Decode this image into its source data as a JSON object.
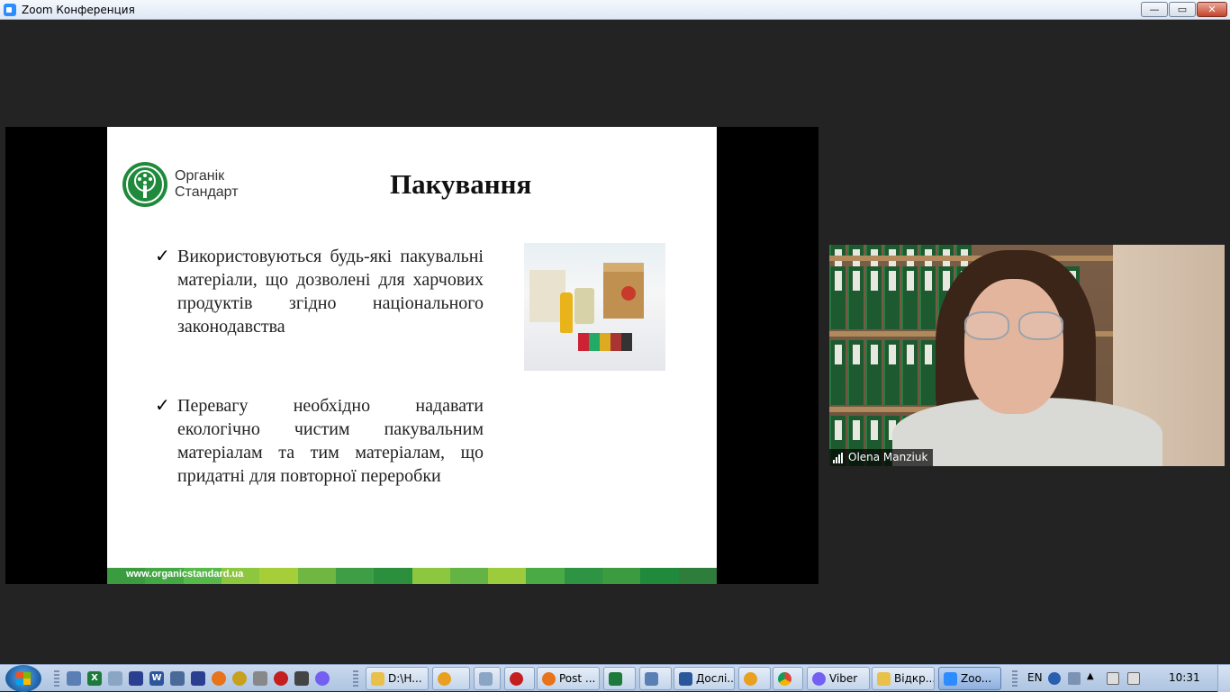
{
  "window": {
    "title": "Zoom Конференция",
    "controls": {
      "minimize": "—",
      "maximize": "▭",
      "close": "✕"
    }
  },
  "slide": {
    "logo_line1": "Органік",
    "logo_line2": "Стандарт",
    "title": "Пакування",
    "bullets": [
      "Використовуються будь-які пакувальні матеріали, що дозволені для харчових продуктів згідно національного законодавства",
      "Перевагу необхідно надавати екологічно чистим пакувальним матеріалам та тим матеріалам, що придатні для повторної переробки"
    ],
    "check": "✓",
    "footer_url": "www.organicstandard.ua",
    "footer_colors": [
      "#3a9b3f",
      "#43a843",
      "#57b94a",
      "#8dc63f",
      "#a6ce39",
      "#6fb742",
      "#3d9e46",
      "#2b8f3e",
      "#8dc63f",
      "#64b345",
      "#9ccb3b",
      "#4aab46",
      "#2e9443",
      "#3a9b3f",
      "#1f8a3b",
      "#2f7d3a"
    ]
  },
  "video": {
    "participant_name": "Olena Manziuk"
  },
  "taskbar": {
    "tasks": [
      "D:\\H...",
      "Post ...",
      "Дослі...",
      "Viber",
      "Відкр...",
      "Zoo..."
    ],
    "language": "EN",
    "clock": "10:31"
  }
}
